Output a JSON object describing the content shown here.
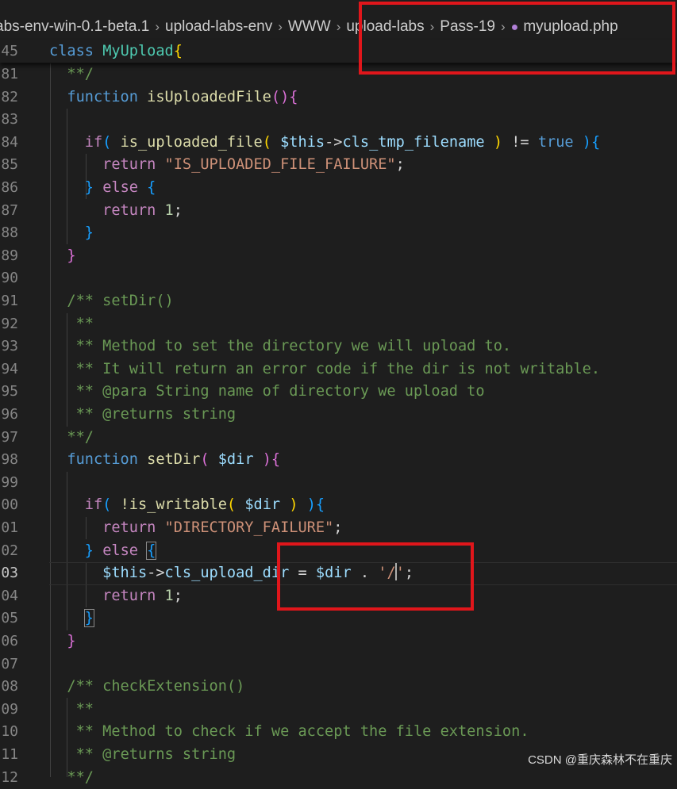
{
  "breadcrumb": {
    "items": [
      "abs-env-win-0.1-beta.1",
      "upload-labs-env",
      "WWW",
      "upload-labs",
      "Pass-19"
    ],
    "file": "myupload.php",
    "file_icon": "php-elephant-icon",
    "separator": "›"
  },
  "sticky": {
    "line_number": "45"
  },
  "editor": {
    "active_line": "03",
    "lines": [
      {
        "n": "81"
      },
      {
        "n": "82"
      },
      {
        "n": "83"
      },
      {
        "n": "84"
      },
      {
        "n": "85"
      },
      {
        "n": "86"
      },
      {
        "n": "87"
      },
      {
        "n": "88"
      },
      {
        "n": "89"
      },
      {
        "n": "90"
      },
      {
        "n": "91"
      },
      {
        "n": "92"
      },
      {
        "n": "93"
      },
      {
        "n": "94"
      },
      {
        "n": "95"
      },
      {
        "n": "96"
      },
      {
        "n": "97"
      },
      {
        "n": "98"
      },
      {
        "n": "99"
      },
      {
        "n": "00"
      },
      {
        "n": "01"
      },
      {
        "n": "02"
      },
      {
        "n": "03"
      },
      {
        "n": "04"
      },
      {
        "n": "05"
      },
      {
        "n": "06"
      },
      {
        "n": "07"
      },
      {
        "n": "08"
      },
      {
        "n": "09"
      },
      {
        "n": "10"
      },
      {
        "n": "11"
      },
      {
        "n": "12"
      }
    ],
    "code": {
      "class_kw": "class",
      "class_name": "MyUpload",
      "brace_open": "{",
      "c_end": "**/",
      "fn_kw": "function",
      "fn1": "isUploadedFile",
      "parens": "()",
      "if_kw": "if",
      "fn_is_uploaded": "is_uploaded_file",
      "this_var": "$this",
      "arrow": "->",
      "prop_tmp": "cls_tmp_filename",
      "neq": "!=",
      "true_kw": "true",
      "return_kw": "return",
      "str_failure": "\"IS_UPLOADED_FILE_FAILURE\"",
      "semi": ";",
      "else_kw": "else",
      "num_one": "1",
      "brace_close": "}",
      "c_setdir": "/** setDir()",
      "c_star": "**",
      "c_method": "** Method to set the directory we will upload to.",
      "c_error": "** It will return an error code if the dir is not writable.",
      "c_para": "** @para String name of directory we upload to",
      "c_returns": "** @returns string",
      "fn2": "setDir",
      "dir_var": "$dir",
      "fn_is_writable": "!is_writable",
      "str_dir_failure": "\"DIRECTORY_FAILURE\"",
      "prop_upload_a": "cls_upload_d",
      "prop_upload_b": "r",
      "assign": "=",
      "dot": ".",
      "quote": "'",
      "slash": "/",
      "c_check": "/** checkExtension()",
      "c_accept": "** Method to check if we accept the file extension.",
      "c_tail": "**/"
    }
  },
  "watermark": "CSDN @重庆森林不在重庆",
  "colors": {
    "background": "#1e1e1e",
    "keyword": "#569cd6",
    "function": "#dcdcaa",
    "class": "#4ec9b0",
    "string": "#ce9178",
    "variable": "#9cdcfe",
    "comment": "#6a9955",
    "number": "#b5cea8",
    "annotation_box": "#e0161b"
  }
}
